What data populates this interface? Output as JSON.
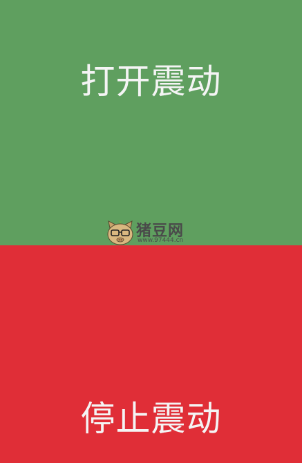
{
  "buttons": {
    "start_label": "打开震动",
    "stop_label": "停止震动"
  },
  "watermark": {
    "title": "猪豆网",
    "url": "www.97444.cn"
  },
  "colors": {
    "start_bg": "#5f9f5f",
    "stop_bg": "#e02e37",
    "label_text": "#f4f4f4"
  },
  "icons": {
    "watermark_logo": "pig-with-glasses-icon"
  }
}
